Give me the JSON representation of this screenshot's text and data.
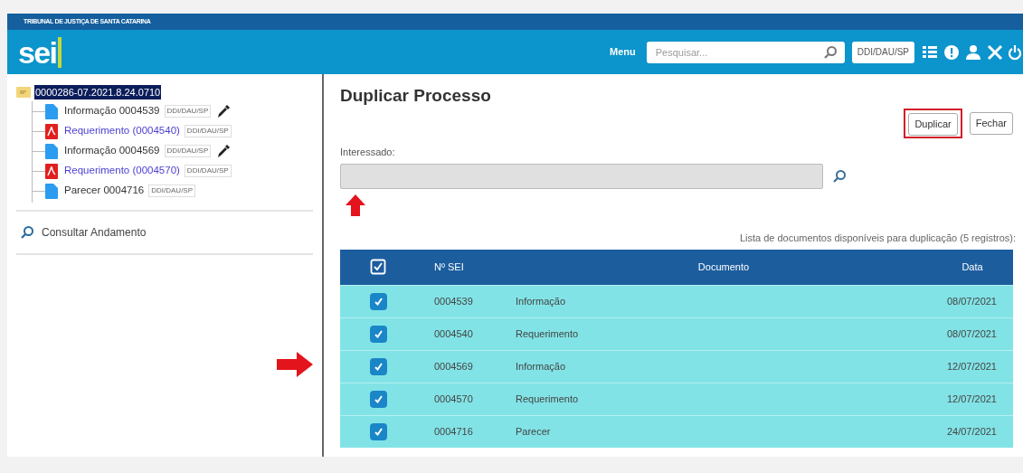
{
  "header": {
    "org": "TRIBUNAL DE JUSTIÇA DE SANTA CATARINA",
    "logo": "sei",
    "menu": "Menu",
    "search": {
      "placeholder": "Pesquisar..."
    },
    "unit": "DDI/DAU/SP"
  },
  "tree": {
    "process": "0000286-07.2021.8.24.0710",
    "selected": true,
    "children": [
      {
        "kind": "doc",
        "label": "Informação 0004539",
        "unit": "DDI/DAU/SP",
        "signed": true
      },
      {
        "kind": "pdf",
        "label": "Requerimento (0004540)",
        "unit": "DDI/DAU/SP",
        "signed": false
      },
      {
        "kind": "doc",
        "label": "Informação 0004569",
        "unit": "DDI/DAU/SP",
        "signed": true
      },
      {
        "kind": "pdf",
        "label": "Requerimento (0004570)",
        "unit": "DDI/DAU/SP",
        "signed": false
      },
      {
        "kind": "doc",
        "label": "Parecer 0004716",
        "unit": "DDI/DAU/SP",
        "signed": false
      }
    ]
  },
  "sidebar_link": "Consultar Andamento",
  "title": "Duplicar Processo",
  "buttons": [
    {
      "label": "Duplicar",
      "highlighted": true
    },
    {
      "label": "Fechar",
      "highlighted": false
    }
  ],
  "field": {
    "label": "Interessado:"
  },
  "caption": "Lista de documentos disponíveis para duplicação (5 registros):",
  "table": {
    "all_checked": true,
    "columns": [
      "Nº SEI",
      "Documento",
      "Data"
    ],
    "rows": [
      {
        "checked": true,
        "number": "0004539",
        "document": "Informação",
        "date": "08/07/2021"
      },
      {
        "checked": true,
        "number": "0004540",
        "document": "Requerimento",
        "date": "08/07/2021"
      },
      {
        "checked": true,
        "number": "0004569",
        "document": "Informação",
        "date": "12/07/2021"
      },
      {
        "checked": true,
        "number": "0004570",
        "document": "Requerimento",
        "date": "12/07/2021"
      },
      {
        "checked": true,
        "number": "0004716",
        "document": "Parecer",
        "date": "24/07/2021"
      }
    ]
  }
}
